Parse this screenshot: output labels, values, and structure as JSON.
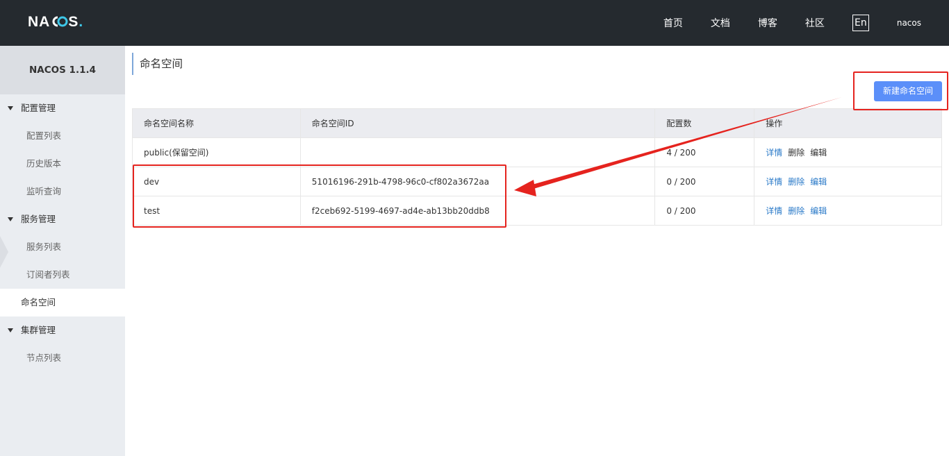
{
  "header": {
    "logo_left": "NA",
    "logo_right": "S",
    "logo_dot": ".",
    "nav": [
      "首页",
      "文档",
      "博客",
      "社区"
    ],
    "lang": "En",
    "user": "nacos"
  },
  "sidebar": {
    "title": "NACOS 1.1.4",
    "groups": [
      {
        "label": "配置管理",
        "items": [
          "配置列表",
          "历史版本",
          "监听查询"
        ]
      },
      {
        "label": "服务管理",
        "items": [
          "服务列表",
          "订阅者列表"
        ]
      },
      {
        "active": "命名空间"
      },
      {
        "label": "集群管理",
        "items": [
          "节点列表"
        ]
      }
    ]
  },
  "main": {
    "title": "命名空间",
    "new_button": "新建命名空间",
    "columns": [
      "命名空间名称",
      "命名空间ID",
      "配置数",
      "操作"
    ],
    "rows": [
      {
        "name": "public(保留空间)",
        "id": "",
        "count": "4 / 200",
        "actions": [
          "详情",
          "删除",
          "编辑"
        ]
      },
      {
        "name": "dev",
        "id": "51016196-291b-4798-96c0-cf802a3672aa",
        "count": "0 / 200",
        "actions": [
          "详情",
          "删除",
          "编辑"
        ]
      },
      {
        "name": "test",
        "id": "f2ceb692-5199-4697-ad4e-ab13bb20ddb8",
        "count": "0 / 200",
        "actions": [
          "详情",
          "删除",
          "编辑"
        ]
      }
    ]
  },
  "colors": {
    "accent": "#5b8ff9",
    "annotation": "#e5231e",
    "header_bg": "#252a2f"
  }
}
